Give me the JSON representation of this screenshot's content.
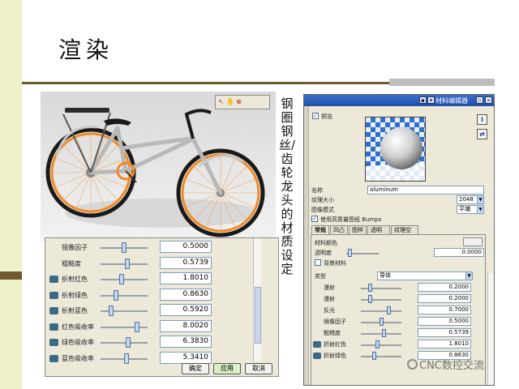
{
  "slide": {
    "title": "渲染",
    "vertical_caption": "钢圈钢丝/齿轮龙头的材质设定"
  },
  "colors": {
    "accent_band": "#efefc9",
    "rule": "#6e5a2c",
    "bike_orange": "#f08a24",
    "panel_bg": "#ece9d8",
    "titlebar": "#2a5cb8"
  },
  "render_view": {
    "toolbar_icons": [
      "cursor-icon",
      "hand-icon",
      "zoom-icon"
    ]
  },
  "param_panel": {
    "rows": [
      {
        "label": "镜像因子",
        "value": "0.5000",
        "icon": false,
        "level": 0.5
      },
      {
        "label": "粗糙度",
        "value": "0.5739",
        "icon": false,
        "level": 0.57
      },
      {
        "label": "折射红色",
        "value": "1.8010",
        "icon": true,
        "level": 0.45
      },
      {
        "label": "折射绿色",
        "value": "0.8630",
        "icon": true,
        "level": 0.3
      },
      {
        "label": "折射蓝色",
        "value": "0.5920",
        "icon": true,
        "level": 0.2
      },
      {
        "label": "红色吸收率",
        "value": "8.0020",
        "icon": true,
        "level": 0.8
      },
      {
        "label": "绿色吸收率",
        "value": "6.3830",
        "icon": true,
        "level": 0.6
      },
      {
        "label": "蓝色吸收率",
        "value": "5.3410",
        "icon": true,
        "level": 0.55
      }
    ],
    "buttons": {
      "ok": "确定",
      "apply": "应用",
      "cancel": "取消"
    }
  },
  "material_editor": {
    "title": "材料编辑器",
    "preview_label": "预览",
    "name_label": "名称",
    "name_value": "aluminum",
    "texture_size_label": "纹理大小",
    "texture_size_value": "2048",
    "image_mode_label": "图像模式",
    "image_mode_value": "平铺",
    "bumps_label": "使用高质量图纸 Bumps",
    "tabs": [
      "常规",
      "凹凸",
      "图样",
      "透明度",
      "纹理空间"
    ],
    "material_color_label": "材料颜色",
    "transparency_label": "透明度",
    "transparency_value": "0.0000",
    "background_material_label": "背景材料",
    "type_label": "类型",
    "type_value": "导体",
    "rows": [
      {
        "label": "漫射",
        "value": "0.2000",
        "icon": false,
        "level": 0.2
      },
      {
        "label": "漫射",
        "value": "0.2000",
        "icon": false,
        "level": 0.2
      },
      {
        "label": "反光",
        "value": "0.7000",
        "icon": false,
        "level": 0.7
      },
      {
        "label": "镜像因子",
        "value": "0.5000",
        "icon": false,
        "level": 0.5
      },
      {
        "label": "粗糙度",
        "value": "0.5739",
        "icon": false,
        "level": 0.57
      },
      {
        "label": "折射红色",
        "value": "1.8010",
        "icon": true,
        "level": 0.4
      },
      {
        "label": "折射绿色",
        "value": "0.8630",
        "icon": true,
        "level": 0.3
      }
    ]
  },
  "watermark": "CNC数控交流"
}
